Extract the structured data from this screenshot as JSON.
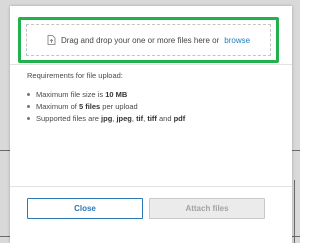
{
  "drop_zone": {
    "text": "Drag and drop your one or more files here or",
    "browse_label": "browse"
  },
  "requirements": {
    "title": "Requirements for file upload:",
    "max_size": {
      "prefix": "Maximum file size is ",
      "value": "10 MB"
    },
    "max_files": {
      "prefix": "Maximum of ",
      "value": "5 files",
      "suffix": " per upload"
    },
    "types": {
      "prefix": "Supported files are ",
      "t1": "jpg",
      "sep1": ", ",
      "t2": "jpeg",
      "sep2": ", ",
      "t3": "tif",
      "sep3": ", ",
      "t4": "tiff",
      "sep4": " and ",
      "t5": "pdf"
    }
  },
  "buttons": {
    "close_label": "Close",
    "attach_label": "Attach files"
  },
  "colors": {
    "highlight": "#22b14c",
    "link": "#1c7ec0",
    "primary_outline": "#2b79b8"
  },
  "icons": {
    "upload": "file-upload-icon"
  }
}
